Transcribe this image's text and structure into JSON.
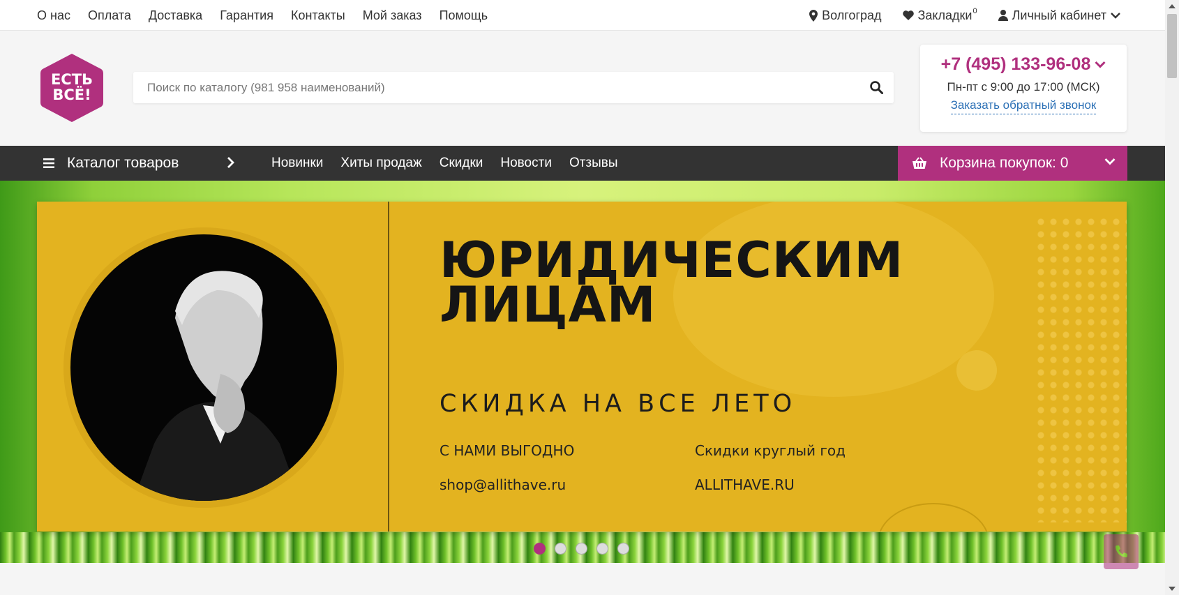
{
  "topnav": {
    "items": [
      "О нас",
      "Оплата",
      "Доставка",
      "Гарантия",
      "Контакты",
      "Мой заказ",
      "Помощь"
    ]
  },
  "topright": {
    "city": "Волгоград",
    "bookmarks": "Закладки",
    "bookmarks_count": "0",
    "account": "Личный кабинет",
    "icons": [
      "map-marker-icon",
      "heart-icon",
      "user-icon",
      "chevron-down-icon"
    ]
  },
  "logo": {
    "text_line1": "ЕСТЬ",
    "text_line2": "ВСЁ!",
    "color": "#b0307e"
  },
  "search": {
    "placeholder": "Поиск по каталогу (981 958 наименований)",
    "value": "",
    "icon": "search-icon"
  },
  "contact": {
    "phone": "+7 (495) 133-96-08",
    "hours": "Пн-пт с 9:00 до 17:00 (МСК)",
    "callback": "Заказать обратный звонок"
  },
  "menu": {
    "catalog": "Каталог товаров",
    "items": [
      "Новинки",
      "Хиты продаж",
      "Скидки",
      "Новости",
      "Отзывы"
    ],
    "cart": "Корзина покупок: 0"
  },
  "banner": {
    "headline_line1": "ЮРИДИЧЕСКИМ",
    "headline_line2": "ЛИЦАМ",
    "subtitle": "СКИДКА НА ВСЕ ЛЕТО",
    "left_line1": "С НАМИ ВЫГОДНО",
    "left_line2": "shop@allithave.ru",
    "right_line1": "Скидки круглый год",
    "right_line2": "ALLITHAVE.RU",
    "slides_total": 5,
    "active_slide": 1
  },
  "colors": {
    "accent": "#b0307e",
    "menubar": "#333333",
    "banner_yellow": "#e3b320",
    "link_blue": "#2a6fb5"
  }
}
